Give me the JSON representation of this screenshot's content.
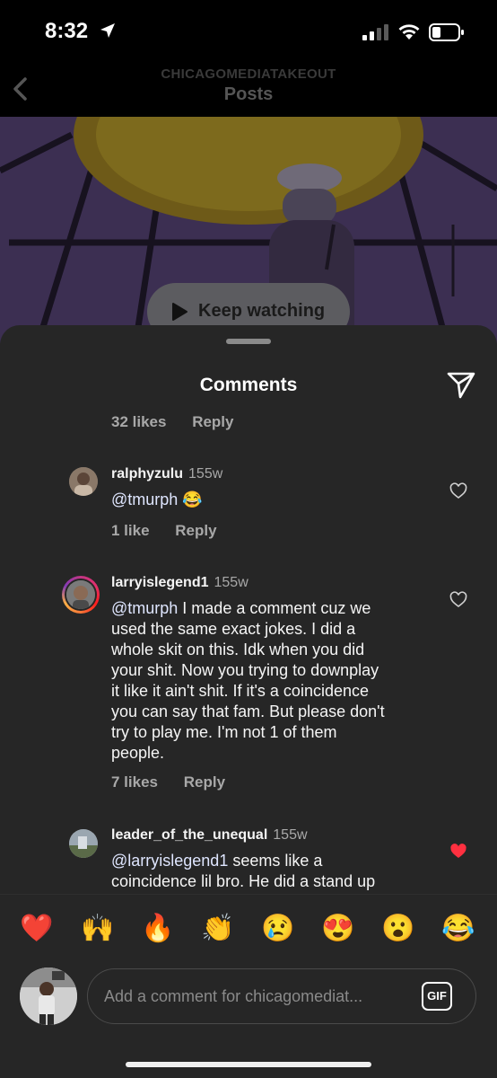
{
  "status_bar": {
    "time": "8:32"
  },
  "header": {
    "subtitle": "CHICAGOMEDIATAKEOUT",
    "title": "Posts"
  },
  "video": {
    "keep_watching_label": "Keep watching"
  },
  "sheet": {
    "title": "Comments"
  },
  "comments": {
    "prev": {
      "likes": "32 likes",
      "reply": "Reply"
    },
    "c1": {
      "username": "ralphyzulu",
      "time": "155w",
      "mention": "@tmurph",
      "text": "😂",
      "likes": "1 like",
      "reply": "Reply",
      "liked": false
    },
    "c2": {
      "username": "larryislegend1",
      "time": "155w",
      "mention": "@tmurph",
      "line1": " I made a comment cuz we",
      "line2": "used the same exact jokes. I did a",
      "line3": "whole skit on this. Idk when you did",
      "line4": "your shit. Now you trying to downplay",
      "line5": "it like it ain't shit. If it's a coincidence",
      "line6": "you can say that fam. But please don't",
      "line7": "try to play me. I'm not 1 of them",
      "line8": "people.",
      "likes": "7 likes",
      "reply": "Reply",
      "liked": false
    },
    "c3": {
      "username": "leader_of_the_unequal",
      "time": "155w",
      "mention": "@larryislegend1",
      "line1": " seems like a",
      "line2": "coincidence lil bro. He did a stand up",
      "liked": true
    }
  },
  "emoji_bar": {
    "items": [
      "❤️",
      "🙌",
      "🔥",
      "👏",
      "😢",
      "😍",
      "😮",
      "😂"
    ]
  },
  "composer": {
    "placeholder": "Add a comment for chicagomediat...",
    "gif_label": "GIF"
  },
  "colors": {
    "sheet_bg": "#262626",
    "heart_liked": "#ff3040",
    "meta_text": "#a8a8a8"
  }
}
